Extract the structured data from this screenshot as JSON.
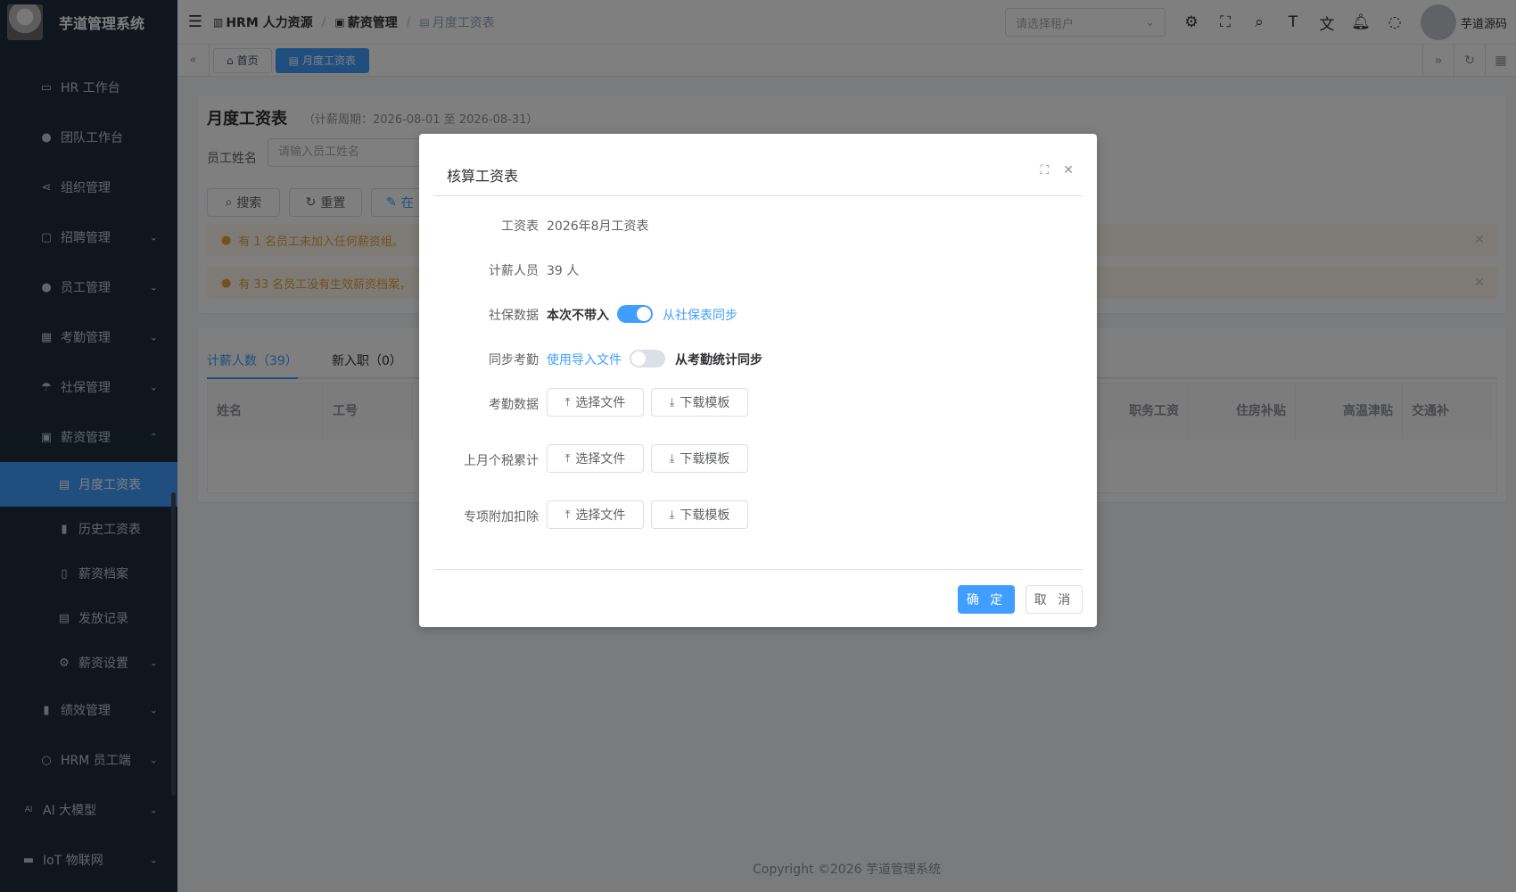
{
  "app": {
    "title": "芋道管理系统"
  },
  "sidebar": {
    "items": [
      {
        "label": "HR 工作台",
        "icon": "monitor-icon"
      },
      {
        "label": "团队工作台",
        "icon": "user-icon"
      },
      {
        "label": "组织管理",
        "icon": "share-icon"
      },
      {
        "label": "招聘管理",
        "icon": "briefcase-icon"
      },
      {
        "label": "员工管理",
        "icon": "user-icon"
      },
      {
        "label": "考勤管理",
        "icon": "calendar-icon"
      },
      {
        "label": "社保管理",
        "icon": "umbrella-icon"
      },
      {
        "label": "薪资管理",
        "icon": "wallet-icon"
      }
    ],
    "salary_sub": [
      {
        "label": "月度工资表",
        "icon": "document-icon"
      },
      {
        "label": "历史工资表",
        "icon": "bar-chart-icon"
      },
      {
        "label": "薪资档案",
        "icon": "archive-icon"
      },
      {
        "label": "发放记录",
        "icon": "list-icon"
      },
      {
        "label": "薪资设置",
        "icon": "gear-icon"
      }
    ],
    "items_after": [
      {
        "label": "绩效管理",
        "icon": "bar-chart-icon"
      },
      {
        "label": "HRM 员工端",
        "icon": "user-icon"
      }
    ],
    "top_items": [
      {
        "label": "AI 大模型",
        "icon": "ai-icon"
      },
      {
        "label": "IoT 物联网",
        "icon": "iot-icon"
      }
    ]
  },
  "header": {
    "breadcrumb": [
      "HRM 人力资源",
      "薪资管理",
      "月度工资表"
    ],
    "tenant_placeholder": "请选择租户",
    "username": "芋道源码"
  },
  "tags": {
    "home": "首页",
    "current": "月度工资表"
  },
  "page": {
    "title": "月度工资表",
    "subtitle": "（计薪周期：2026-08-01 至 2026-08-31）",
    "employee_label": "员工姓名",
    "employee_placeholder": "请输入员工姓名",
    "search_btn": "搜索",
    "reset_btn": "重置",
    "third_btn": "在",
    "alert1": "有 1 名员工未加入任何薪资组。",
    "alert2": "有 33 名员工没有生效薪资档案，",
    "tab1": "计薪人数（39）",
    "tab2": "新入职（0）",
    "columns_left": [
      "姓名",
      "工号"
    ],
    "columns_right": [
      "职务工资",
      "住房补贴",
      "高温津贴",
      "交通补"
    ],
    "copyright": "Copyright ©2026 芋道管理系统"
  },
  "dialog": {
    "title": "核算工资表",
    "payroll_label": "工资表",
    "payroll_value": "2026年8月工资表",
    "staff_label": "计薪人员",
    "staff_value": "39 人",
    "social_label": "社保数据",
    "social_off": "本次不带入",
    "social_on": "从社保表同步",
    "social_switch_on": true,
    "attend_sync_label": "同步考勤",
    "attend_sync_off": "使用导入文件",
    "attend_sync_on": "从考勤统计同步",
    "attend_switch_on": false,
    "attend_data_label": "考勤数据",
    "tax_label": "上月个税累计",
    "special_label": "专项附加扣除",
    "select_file": "选择文件",
    "download_template": "下载模板",
    "confirm": "确 定",
    "cancel": "取 消"
  },
  "colors": {
    "primary": "#409eff",
    "sidebar_bg": "#1f2d3d"
  }
}
